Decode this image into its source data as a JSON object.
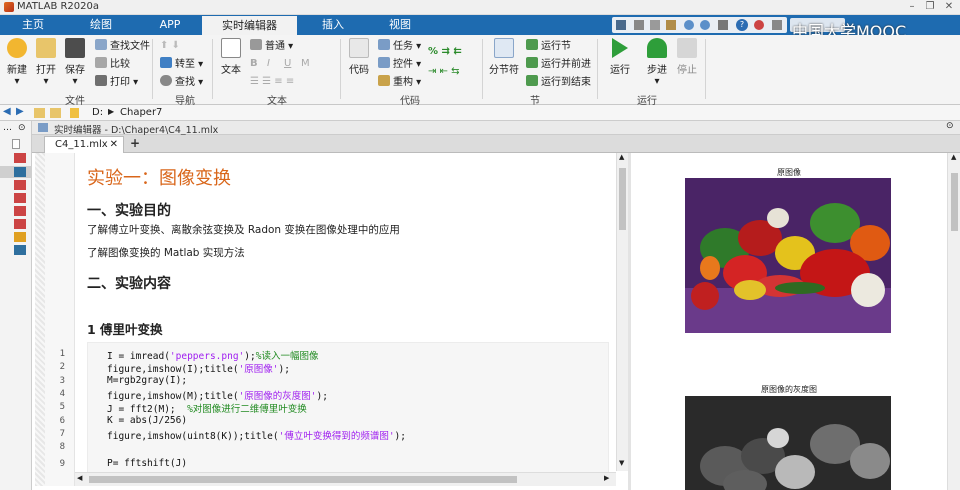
{
  "app_title": "MATLAB R2020a",
  "ribbon_tabs": [
    "主页",
    "绘图",
    "APP",
    "实时编辑器",
    "插入",
    "视图"
  ],
  "active_tab": "实时编辑器",
  "watermark": "中国大学MOOC",
  "ribbon": {
    "file": {
      "new": "新建",
      "open": "打开",
      "save": "保存",
      "find_files": "查找文件",
      "compare": "比较",
      "print": "打印",
      "group": "文件"
    },
    "nav": {
      "goto": "转至",
      "find": "查找",
      "group": "导航"
    },
    "text": {
      "text": "文本",
      "style": "普通",
      "bold": "B",
      "italic": "I",
      "underline": "U",
      "mono": "M",
      "group": "文本"
    },
    "code": {
      "code": "代码",
      "task": "任务",
      "control": "控件",
      "refactor": "重构",
      "group": "代码"
    },
    "section": {
      "break": "分节符",
      "run_section": "运行节",
      "run_advance": "运行并前进",
      "run_to_end": "运行到结束",
      "group": "节"
    },
    "run": {
      "run": "运行",
      "step": "步进",
      "stop": "停止",
      "group": "运行"
    }
  },
  "address": {
    "drive": "D:",
    "folder": "Chaper7"
  },
  "editor_header": "实时编辑器 - D:\\Chaper4\\C4_11.mlx",
  "doc_tab": "C4_11.mlx",
  "doc_tab_add": "+",
  "content": {
    "title": "实验一：图像变换",
    "h1": "一、实验目的",
    "p1": "了解傅立叶变换、离散余弦变换及 Radon 变换在图像处理中的应用",
    "p2": "了解图像变换的 Matlab 实现方法",
    "h2": "二、实验内容",
    "h3": "1 傅里叶变换"
  },
  "code_lines": [
    {
      "n": "1",
      "a": "I = imread(",
      "s": "'peppers.png'",
      "b": ");",
      "c": "%读入一幅图像"
    },
    {
      "n": "2",
      "a": "figure,imshow(I);title(",
      "s": "'原图像'",
      "b": ");",
      "c": ""
    },
    {
      "n": "3",
      "a": "M=rgb2gray(I);",
      "s": "",
      "b": "",
      "c": ""
    },
    {
      "n": "4",
      "a": "figure,imshow(M);title(",
      "s": "'原图像的灰度图'",
      "b": ");",
      "c": ""
    },
    {
      "n": "5",
      "a": "J = fft2(M);  ",
      "s": "",
      "b": "",
      "c": "%对图像进行二维傅里叶变换"
    },
    {
      "n": "6",
      "a": "K = abs(J/256)",
      "s": "",
      "b": "",
      "c": ""
    },
    {
      "n": "7",
      "a": "figure,imshow(uint8(K));title(",
      "s": "'傅立叶变换得到的频谱图'",
      "b": ");",
      "c": ""
    },
    {
      "n": "8",
      "a": "",
      "s": "",
      "b": "",
      "c": ""
    },
    {
      "n": "9",
      "a": "P= fftshift(J)",
      "s": "",
      "b": "",
      "c": ""
    }
  ],
  "output": {
    "fig1_title": "原图像",
    "fig2_title": "原图像的灰度图"
  },
  "colors": {
    "ribbon_blue": "#1e6bb0",
    "heading_orange": "#d9661a",
    "string_purple": "#a020f0",
    "comment_green": "#228b22"
  }
}
